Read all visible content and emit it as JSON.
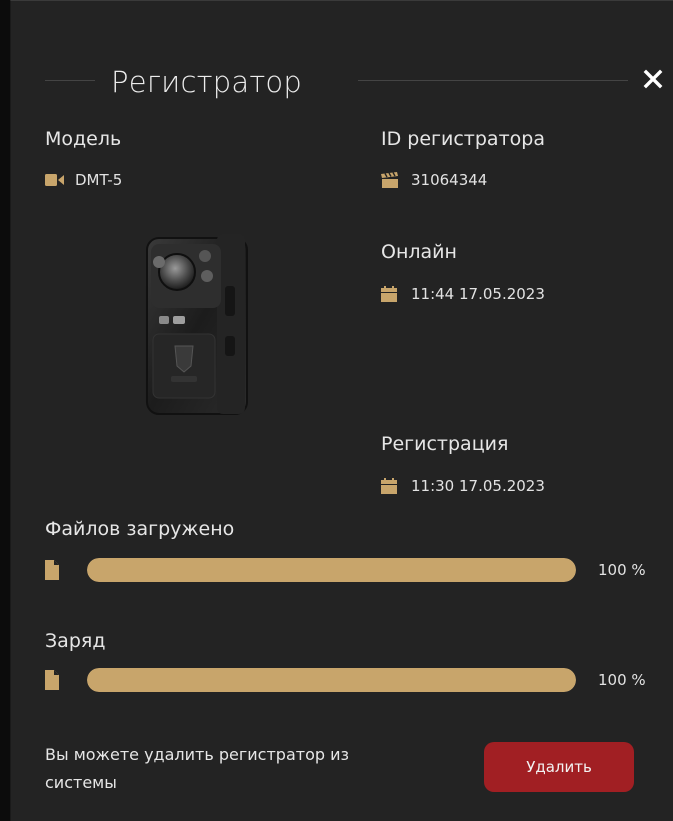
{
  "dialog": {
    "title": "Регистратор"
  },
  "model": {
    "label": "Модель",
    "value": "DMT-5",
    "icon": "video-camera-icon"
  },
  "device_id": {
    "label": "ID регистратора",
    "value": "31064344",
    "icon": "clapperboard-icon"
  },
  "online": {
    "label": "Онлайн",
    "value": "11:44 17.05.2023",
    "icon": "calendar-icon"
  },
  "registration": {
    "label": "Регистрация",
    "value": "11:30 17.05.2023",
    "icon": "calendar-icon"
  },
  "files_uploaded": {
    "label": "Файлов загружено",
    "percent_text": "100 %",
    "progress": 1.0,
    "icon": "file-icon"
  },
  "charge": {
    "label": "Заряд",
    "percent_text": "100 %",
    "progress": 1.0,
    "icon": "file-icon"
  },
  "footer": {
    "message": "Вы можете удалить регистратор из системы",
    "delete_label": "Удалить"
  },
  "colors": {
    "accent": "#c8a56b",
    "danger": "#a11f23",
    "panel_bg": "#232323"
  }
}
